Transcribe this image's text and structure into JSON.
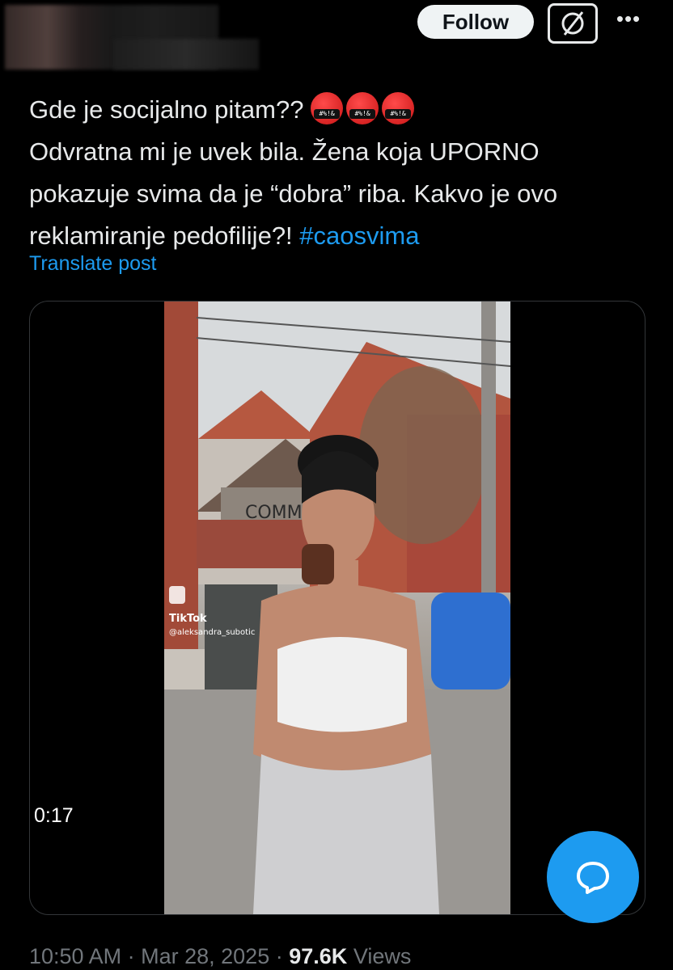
{
  "header": {
    "follow_label": "Follow",
    "grok_icon": "grok-icon",
    "more_icon": "more-icon"
  },
  "tweet": {
    "line1": "Gde je socijalno pitam??",
    "emoji_text": "#%!&",
    "line2": "Odvratna mi je uvek bila. Žena koja UPORNO",
    "line3": "pokazuje svima da je “dobra” riba. Kakvo je ovo",
    "line4": "reklamiranje pedofilije?!",
    "hashtag": "#caosvima",
    "translate_label": "Translate post"
  },
  "video": {
    "duration": "0:17",
    "watermark_brand": "TikTok",
    "watermark_user": "@aleksandra_subotic",
    "wall_graffiti": "COMM"
  },
  "meta": {
    "time": "10:50 AM",
    "separator": "·",
    "date": "Mar 28, 2025",
    "views_count": "97.6K",
    "views_label": "Views"
  },
  "colors": {
    "accent": "#1d9bf0",
    "background": "#000000",
    "text": "#e7e9ea",
    "muted": "#71767b"
  }
}
